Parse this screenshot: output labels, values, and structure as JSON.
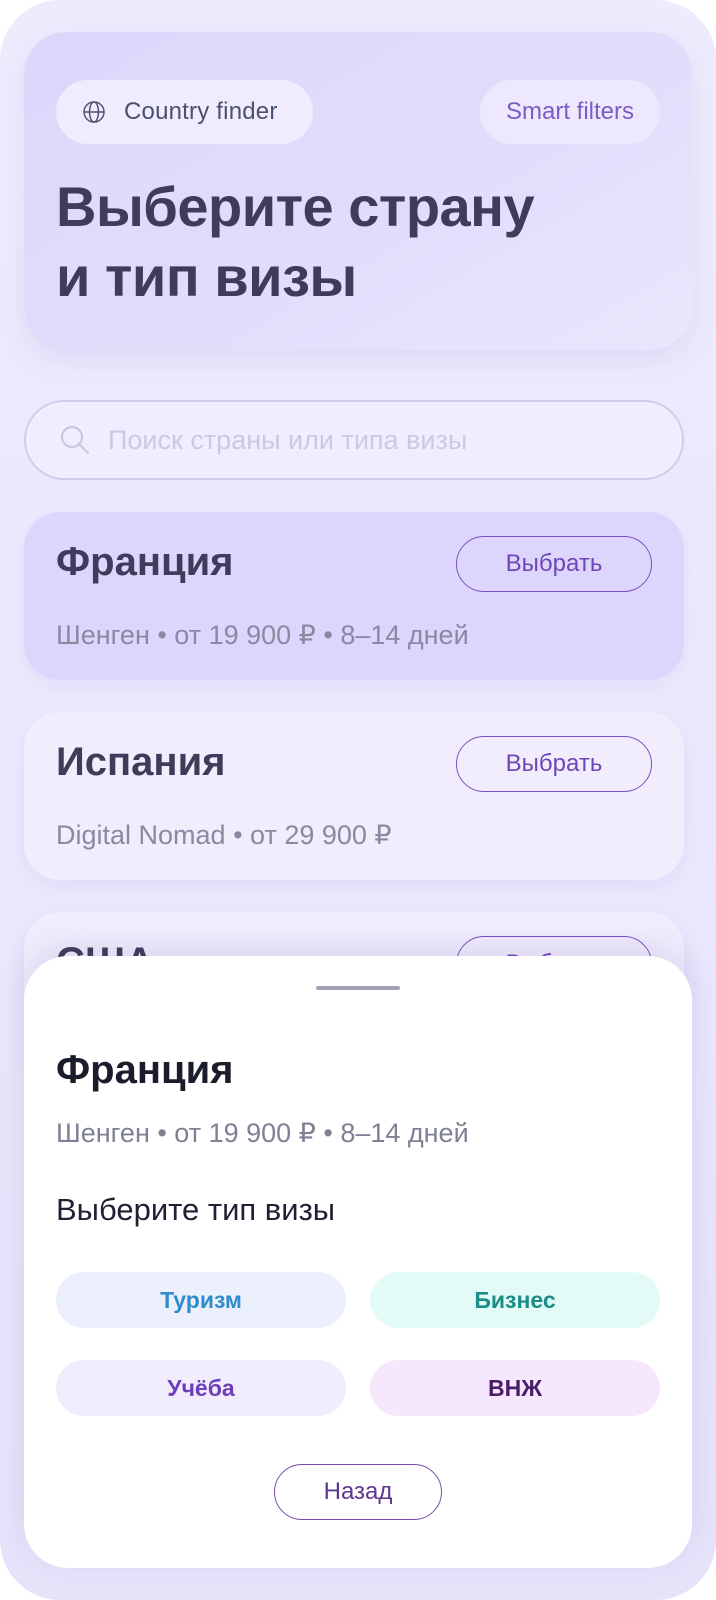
{
  "header": {
    "country_finder_label": "Country finder",
    "smart_filters_label": "Smart filters",
    "title_line1": "Выберите страну",
    "title_line2": "и тип визы"
  },
  "search": {
    "placeholder": "Поиск страны или типа визы",
    "value": ""
  },
  "countries": [
    {
      "name": "Франция",
      "meta": "Шенген • от 19 900 ₽ • 8–14 дней",
      "button": "Выбрать",
      "selected": true
    },
    {
      "name": "Испания",
      "meta": "Digital Nomad • от 29 900 ₽",
      "button": "Выбрать",
      "selected": false
    },
    {
      "name": "США",
      "meta": "",
      "button": "Выбрать",
      "selected": false
    }
  ],
  "sheet": {
    "title": "Франция",
    "meta": "Шенген • от 19 900 ₽ • 8–14 дней",
    "subtitle": "Выберите тип визы",
    "visa_types": [
      "Туризм",
      "Бизнес",
      "Учёба",
      "ВНЖ"
    ],
    "back_label": "Назад"
  },
  "colors": {
    "accent": "#7a52bf",
    "title_text": "#3e3c5a",
    "selected_card": "#dcd5fc",
    "card": "#f1edfd"
  },
  "icons": {
    "country_finder": "globe-icon",
    "search": "search-icon"
  }
}
